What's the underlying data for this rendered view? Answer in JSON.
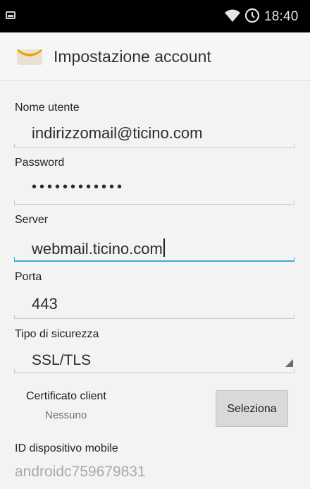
{
  "status_bar": {
    "time": "18:40"
  },
  "action_bar": {
    "title": "Impostazione account",
    "icon": "mail-envelope-icon"
  },
  "fields": {
    "username": {
      "label": "Nome utente",
      "value": "indirizzomail@ticino.com"
    },
    "password": {
      "label": "Password",
      "value": "••••••••••••"
    },
    "server": {
      "label": "Server",
      "value": "webmail.ticino.com"
    },
    "port": {
      "label": "Porta",
      "value": "443"
    },
    "security": {
      "label": "Tipo di sicurezza",
      "value": "SSL/TLS"
    }
  },
  "client_cert": {
    "label": "Certificato client",
    "value": "Nessuno",
    "button_label": "Seleziona"
  },
  "device_id": {
    "label": "ID dispositivo mobile",
    "value": "androidc759679831"
  },
  "colors": {
    "accent": "#43a8d9",
    "statusbar": "#000000",
    "background": "#f3f3f3"
  }
}
